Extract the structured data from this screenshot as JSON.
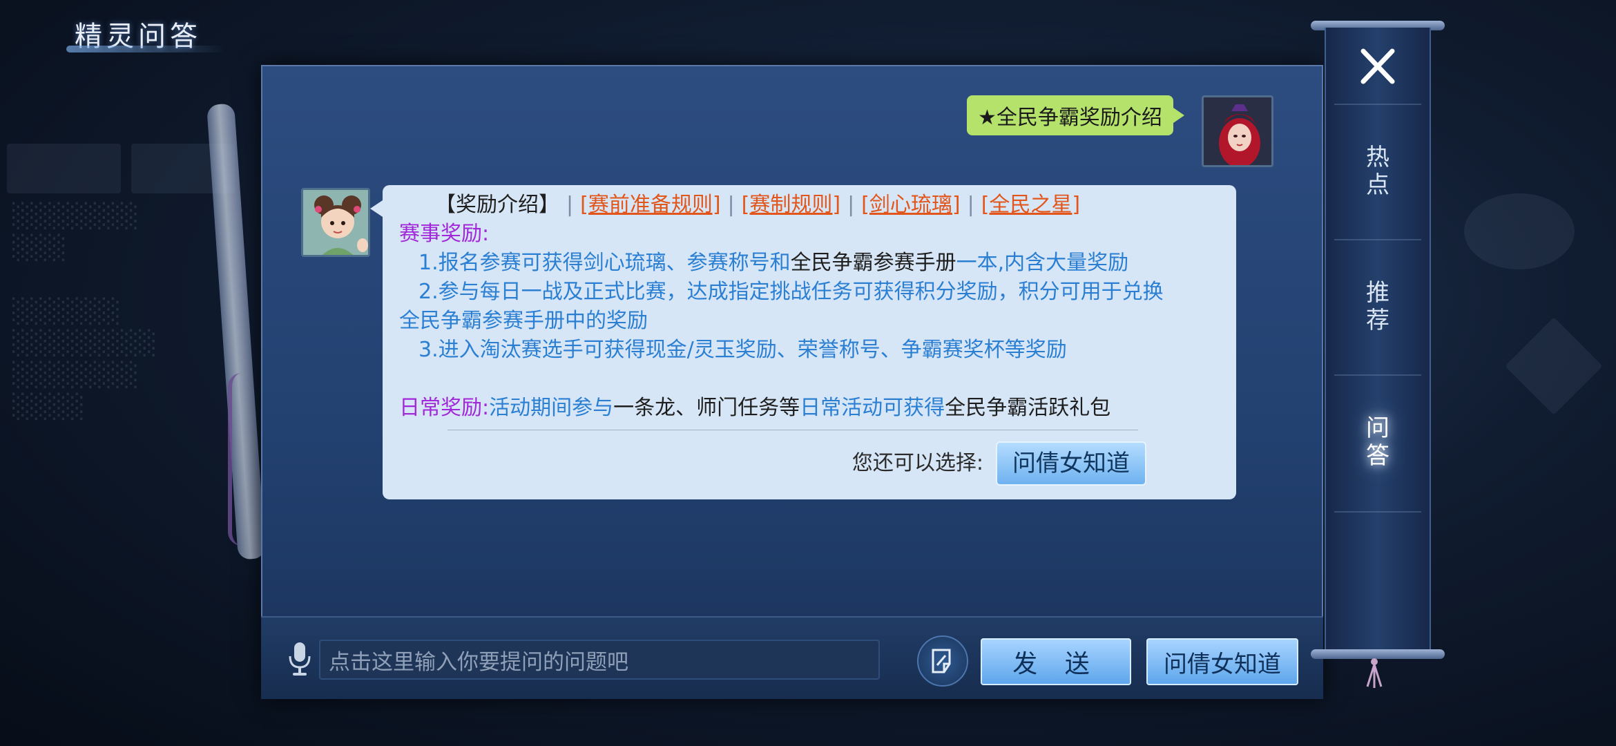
{
  "header": {
    "title": "精灵问答"
  },
  "user_message": {
    "text": "★全民争霸奖励介绍"
  },
  "bot_message": {
    "tabs": {
      "current": "【奖励介绍】",
      "links": [
        "[赛前准备规则]",
        "[赛制规则]",
        "[剑心琉璃]",
        "[全民之星]"
      ],
      "separator": "|"
    },
    "section1_title": "赛事奖励:",
    "line1": {
      "a": "1.报名参赛可获得剑心琉璃、参赛称号和",
      "b": "全民争霸参赛手册",
      "c": "一本,内含大量奖励"
    },
    "line2a": "2.参与每日一战及正式比赛，达成指定挑战任务可获得积分奖励，积分可用于兑换",
    "line2b": "全民争霸参赛手册中的奖励",
    "line3": "3.进入淘汰赛选手可获得现金/灵玉奖励、荣誉称号、争霸赛奖杯等奖励",
    "daily": {
      "title": "日常奖励:",
      "a": "活动期间参与",
      "b": "一条龙、师门任务等",
      "c": "日常活动可获得",
      "d": "全民争霸活跃礼包"
    },
    "choose_label": "您还可以选择:",
    "choose_button": "问倩女知道"
  },
  "input_bar": {
    "placeholder": "点击这里输入你要提问的问题吧",
    "send_label": "发 送",
    "ask_label": "问倩女知道"
  },
  "side_nav": {
    "hot": "热点",
    "recommend": "推荐",
    "qa": "问答"
  },
  "colors": {
    "link": "#e2551b",
    "purple": "#a128d8",
    "blue": "#2a7fd3",
    "bubble_user": "#b5e26a",
    "bubble_bot": "#d7e6f6"
  }
}
